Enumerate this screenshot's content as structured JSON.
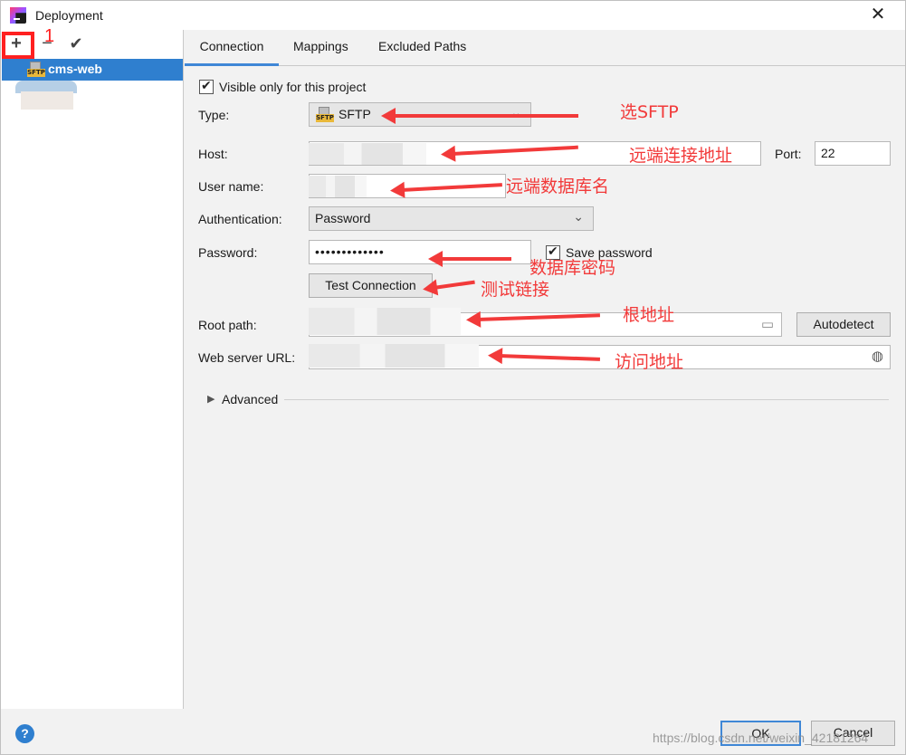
{
  "window": {
    "title": "Deployment",
    "close_glyph": "✕"
  },
  "toolbar": {
    "add_icon": "plus-icon",
    "add_glyph": "+",
    "remove_icon": "minus-icon",
    "remove_glyph": "−",
    "apply_icon": "check-icon",
    "apply_glyph": "✔",
    "annotation_number": "1"
  },
  "server_list": [
    {
      "label": "cms-web",
      "icon": "sftp-icon",
      "icon_text": "SFTP"
    }
  ],
  "tabs": [
    {
      "label": "Connection",
      "active": true
    },
    {
      "label": "Mappings",
      "active": false
    },
    {
      "label": "Excluded Paths",
      "active": false
    }
  ],
  "form": {
    "visible_only": {
      "label": "Visible only for this project",
      "checked": true
    },
    "type": {
      "label": "Type:",
      "value": "SFTP",
      "icon_text": "SFTP"
    },
    "host": {
      "label": "Host:",
      "port_label": "Port:",
      "port_value": "22"
    },
    "username": {
      "label": "User name:"
    },
    "authentication": {
      "label": "Authentication:",
      "value": "Password"
    },
    "password": {
      "label": "Password:",
      "value": "•••••••••••••",
      "save_label": "Save password",
      "save_checked": true
    },
    "test_connection": "Test Connection",
    "root_path": {
      "label": "Root path:",
      "autodetect": "Autodetect"
    },
    "web_server_url": {
      "label": "Web server URL:"
    },
    "advanced": "Advanced"
  },
  "annotations": {
    "type": "选SFTP",
    "host": "远端连接地址",
    "username": "远端数据库名",
    "password": "数据库密码",
    "test": "测试链接",
    "root": "根地址",
    "url": "访问地址"
  },
  "footer": {
    "help": "?",
    "ok": "OK",
    "cancel": "Cancel",
    "watermark": "https://blog.csdn.net/weixin_42181264"
  },
  "colors": {
    "accent": "#2f7fcf",
    "annotation": "#f23a3a",
    "sftp_tag": "#e9b83a"
  }
}
